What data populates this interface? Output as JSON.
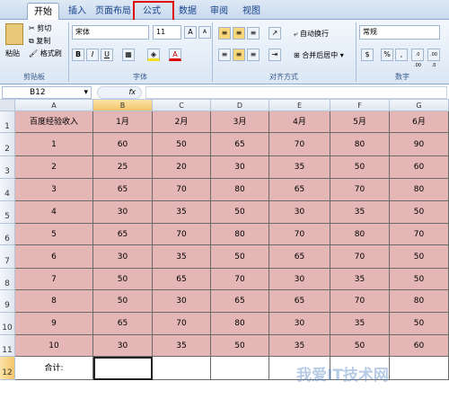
{
  "tabs": [
    "开始",
    "插入",
    "页面布局",
    "公式",
    "数据",
    "审阅",
    "视图"
  ],
  "clipboard": {
    "paste": "粘贴",
    "cut": "剪切",
    "copy": "复制",
    "format_painter": "格式刷",
    "group": "剪贴板"
  },
  "font": {
    "name": "宋体",
    "size": "11",
    "bold": "B",
    "italic": "I",
    "underline": "U",
    "color_a": "A",
    "grow": "A",
    "shrink": "A",
    "group": "字体"
  },
  "alignment": {
    "wrap": "自动换行",
    "merge": "合并后居中",
    "group": "对齐方式"
  },
  "number": {
    "format": "常规",
    "percent": "%",
    "comma": ",",
    "inc_dec": ".0 .00",
    "dec_dec": ".00 .0",
    "group": "数字"
  },
  "formula_bar": {
    "name_box": "B12",
    "fx": "fx"
  },
  "columns": [
    "A",
    "B",
    "C",
    "D",
    "E",
    "F",
    "G"
  ],
  "rows": [
    "1",
    "2",
    "3",
    "4",
    "5",
    "6",
    "7",
    "8",
    "9",
    "10",
    "11",
    "12"
  ],
  "grid": [
    [
      "百度经验收入",
      "1月",
      "2月",
      "3月",
      "4月",
      "5月",
      "6月"
    ],
    [
      "1",
      "60",
      "50",
      "65",
      "70",
      "80",
      "90"
    ],
    [
      "2",
      "25",
      "20",
      "30",
      "35",
      "50",
      "60"
    ],
    [
      "3",
      "65",
      "70",
      "80",
      "65",
      "70",
      "80"
    ],
    [
      "4",
      "30",
      "35",
      "50",
      "30",
      "35",
      "50"
    ],
    [
      "5",
      "65",
      "70",
      "80",
      "70",
      "80",
      "70"
    ],
    [
      "6",
      "30",
      "35",
      "50",
      "65",
      "70",
      "50"
    ],
    [
      "7",
      "50",
      "65",
      "70",
      "30",
      "35",
      "50"
    ],
    [
      "8",
      "50",
      "30",
      "65",
      "65",
      "70",
      "80"
    ],
    [
      "9",
      "65",
      "70",
      "80",
      "30",
      "35",
      "50"
    ],
    [
      "10",
      "30",
      "35",
      "50",
      "35",
      "50",
      "60"
    ],
    [
      "合计:",
      "",
      "",
      "",
      "",
      "",
      ""
    ]
  ],
  "watermark": "我爱IT技术网",
  "colors": {
    "cell_fill": "#e5b6b6",
    "highlight": "#e00000",
    "selected_header": "#f4c56a"
  }
}
